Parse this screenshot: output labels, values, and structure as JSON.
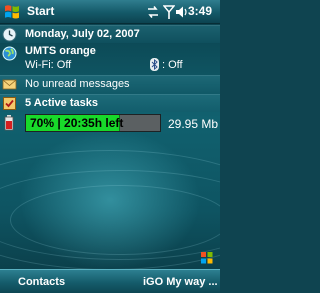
{
  "titlebar": {
    "start_label": "Start",
    "time": "3:49",
    "icons": [
      "windows-logo-icon",
      "connectivity-icon",
      "signal-icon",
      "volume-icon"
    ]
  },
  "today": {
    "date": "Monday, July 02, 2007",
    "operator": "UMTS orange",
    "wifi_status": "Wi-Fi: Off",
    "bluetooth_status": ": Off",
    "messages": "No unread messages",
    "tasks": "5 Active tasks",
    "battery": {
      "percent": 70,
      "label": "70% | 20:35h left"
    },
    "storage": "29.95 Mb"
  },
  "softkeys": {
    "left": "Contacts",
    "right": "iGO My way ..."
  },
  "colors": {
    "battery_fill": "#18d92a",
    "background": "#0f4450"
  }
}
